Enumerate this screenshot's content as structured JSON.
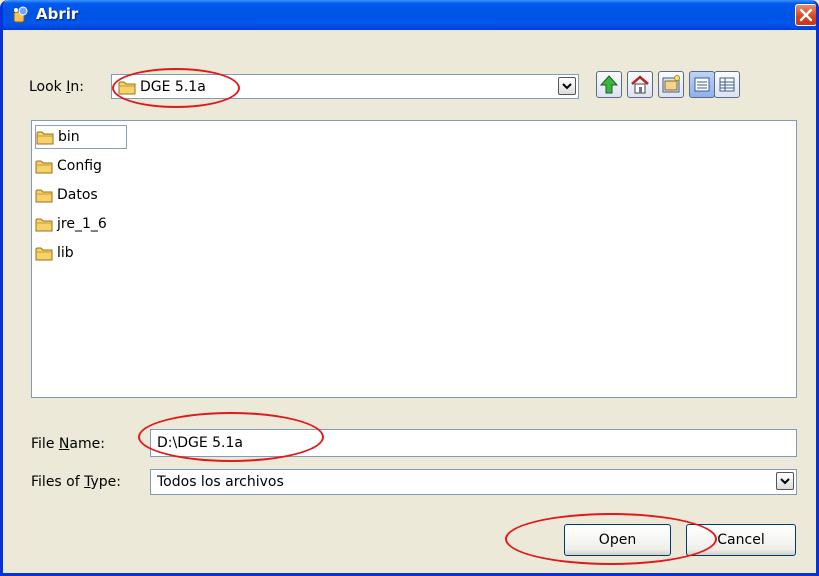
{
  "window": {
    "title": "Abrir",
    "icon": "java-app-icon"
  },
  "lookin": {
    "label_before": "Look ",
    "label_mnemonic": "I",
    "label_after": "n:",
    "value": "DGE 5.1a"
  },
  "toolbar": {
    "buttons": [
      {
        "icon": "up-one-level-icon"
      },
      {
        "icon": "home-icon"
      },
      {
        "icon": "new-folder-icon"
      },
      {
        "icon": "list-view-icon"
      },
      {
        "icon": "details-view-icon"
      }
    ]
  },
  "files": [
    {
      "name": "bin",
      "selected": true
    },
    {
      "name": "Config",
      "selected": false
    },
    {
      "name": "Datos",
      "selected": false
    },
    {
      "name": "jre_1_6",
      "selected": false
    },
    {
      "name": "lib",
      "selected": false
    }
  ],
  "filename": {
    "label_before": "File ",
    "label_mnemonic": "N",
    "label_after": "ame:",
    "value": "D:\\DGE 5.1a"
  },
  "filetype": {
    "label_before": "Files of ",
    "label_mnemonic": "T",
    "label_after": "ype:",
    "value": "Todos los archivos"
  },
  "buttons": {
    "open": "Open",
    "cancel": "Cancel"
  },
  "colors": {
    "titlebar": "#0054E3",
    "annotation": "#E0191B",
    "background": "#ECE9D8"
  }
}
